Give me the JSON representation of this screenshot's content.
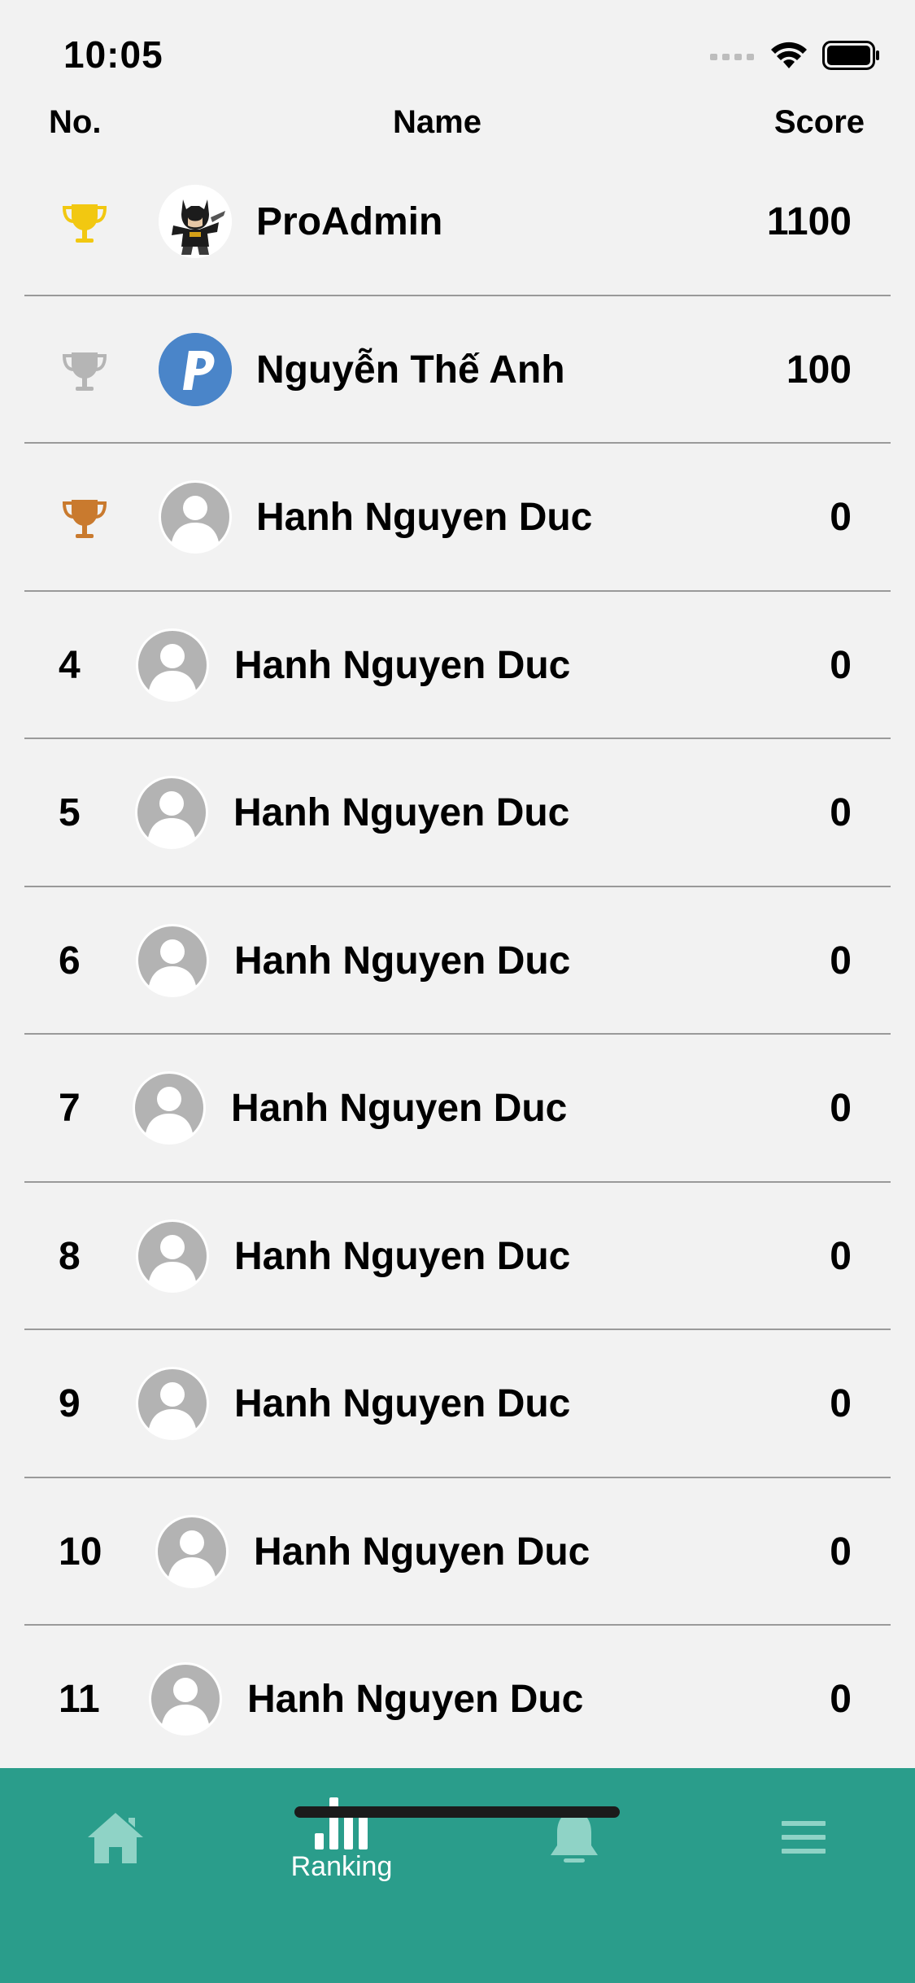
{
  "status": {
    "time": "10:05"
  },
  "header": {
    "no": "No.",
    "name": "Name",
    "score": "Score"
  },
  "rows": [
    {
      "rank": "",
      "trophy": "gold-trophy-icon",
      "avatar": "batman-avatar",
      "name": "ProAdmin",
      "score": "1100"
    },
    {
      "rank": "",
      "trophy": "silver-trophy-icon",
      "avatar": "blue-p-logo-avatar",
      "name": "Nguyễn Thế Anh",
      "score": "100"
    },
    {
      "rank": "",
      "trophy": "bronze-trophy-icon",
      "avatar": "default-user-avatar",
      "name": "Hanh Nguyen Duc",
      "score": "0"
    },
    {
      "rank": "4",
      "avatar": "default-user-avatar",
      "name": "Hanh Nguyen Duc",
      "score": "0"
    },
    {
      "rank": "5",
      "avatar": "default-user-avatar",
      "name": "Hanh Nguyen Duc",
      "score": "0"
    },
    {
      "rank": "6",
      "avatar": "default-user-avatar",
      "name": "Hanh Nguyen Duc",
      "score": "0"
    },
    {
      "rank": "7",
      "avatar": "default-user-avatar",
      "name": "Hanh Nguyen Duc",
      "score": "0"
    },
    {
      "rank": "8",
      "avatar": "default-user-avatar",
      "name": "Hanh Nguyen Duc",
      "score": "0"
    },
    {
      "rank": "9",
      "avatar": "default-user-avatar",
      "name": "Hanh Nguyen Duc",
      "score": "0"
    },
    {
      "rank": "10",
      "avatar": "default-user-avatar",
      "name": "Hanh Nguyen Duc",
      "score": "0"
    },
    {
      "rank": "11",
      "avatar": "default-user-avatar",
      "name": "Hanh Nguyen Duc",
      "score": "0"
    }
  ],
  "tabbar": {
    "home": {
      "icon": "home-icon"
    },
    "ranking": {
      "icon": "bar-chart-icon",
      "label": "Ranking",
      "active": true
    },
    "notifications": {
      "icon": "bell-icon"
    },
    "menu": {
      "icon": "menu-icon"
    }
  },
  "colors": {
    "tabbar": "#2a9d8b",
    "gold": "#f2c811",
    "silver": "#b5b5b5",
    "bronze": "#c97a2e",
    "background": "#f2f2f2"
  }
}
